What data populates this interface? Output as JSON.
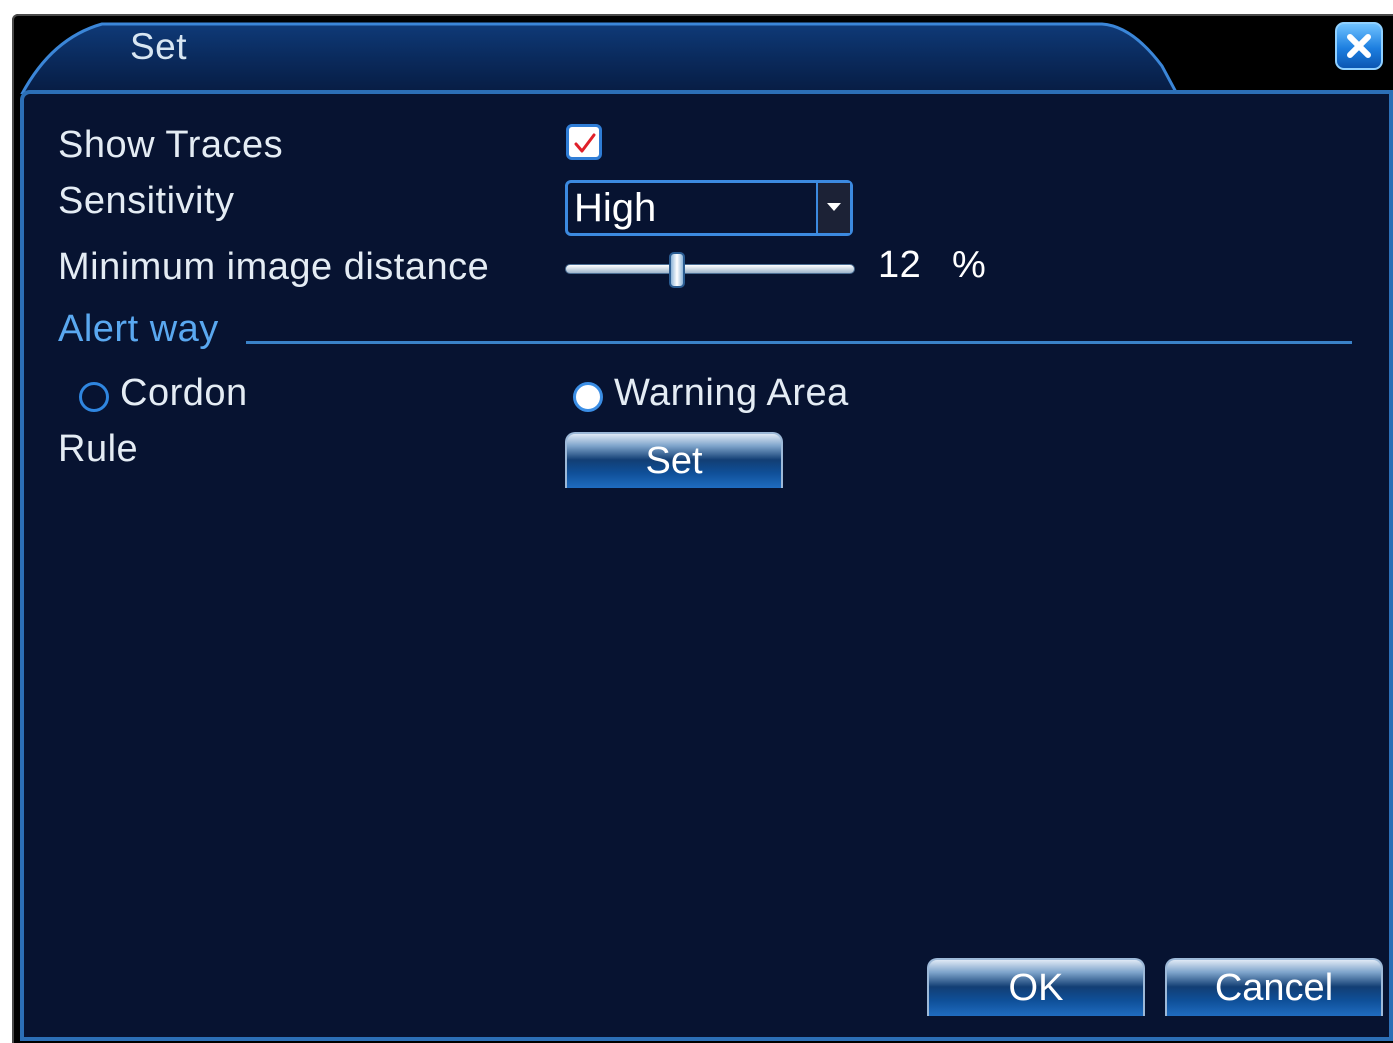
{
  "window": {
    "title": "Set",
    "close_icon": "close-icon"
  },
  "form": {
    "show_traces": {
      "label": "Show Traces",
      "checked": true
    },
    "sensitivity": {
      "label": "Sensitivity",
      "value": "High"
    },
    "min_distance": {
      "label": "Minimum image distance",
      "value": "12",
      "unit": "%"
    },
    "alert_way": {
      "label": "Alert way",
      "options": [
        "Cordon",
        "Warning Area"
      ],
      "selected": "Warning Area"
    },
    "rule": {
      "label": "Rule",
      "button_label": "Set"
    }
  },
  "footer": {
    "ok_label": "OK",
    "cancel_label": "Cancel"
  },
  "colors": {
    "panel_bg": "#071331",
    "accent": "#2c6fb6",
    "section_label": "#5aa8f0",
    "text": "#e4ecf4"
  }
}
